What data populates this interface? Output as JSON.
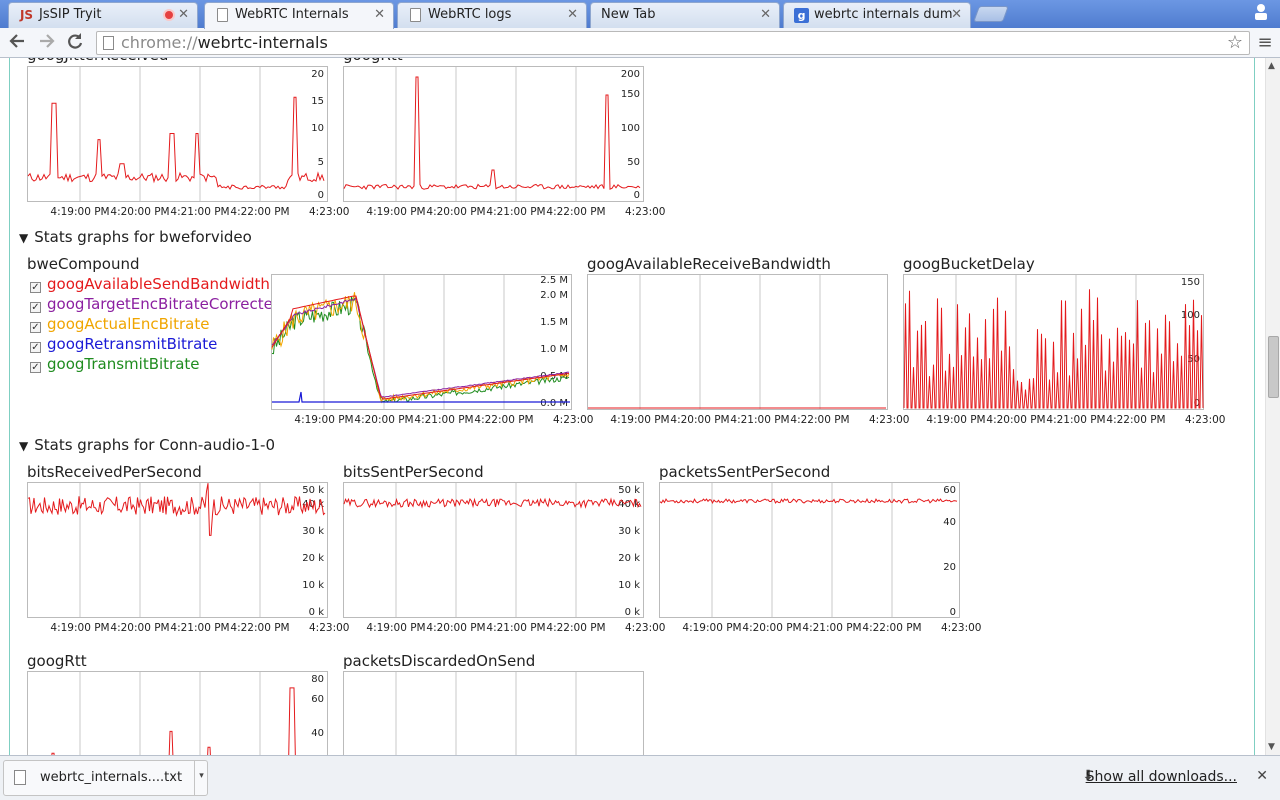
{
  "tabs": [
    {
      "title": "JsSIP Tryit",
      "favicon": "jssip-icon",
      "recording": true
    },
    {
      "title": "WebRTC Internals",
      "favicon": "page-icon",
      "active": true
    },
    {
      "title": "WebRTC logs",
      "favicon": "page-icon"
    },
    {
      "title": "New Tab",
      "favicon": "none"
    },
    {
      "title": "webrtc internals dum",
      "favicon": "google-icon"
    }
  ],
  "toolbar": {
    "url_scheme": "chrome://",
    "url_host": "webrtc-internals"
  },
  "sections": [
    {
      "title": "Stats graphs for bweforvideo"
    },
    {
      "title": "Stats graphs for Conn-audio-1-0"
    }
  ],
  "time_ticks": [
    "4:19:00 PM",
    "4:20:00 PM",
    "4:21:00 PM",
    "4:22:00 PM",
    "4:23:00"
  ],
  "graphs": {
    "g1": {
      "label": "googJitterReceived",
      "yticks": [
        "20",
        "15",
        "10",
        "5",
        "0"
      ]
    },
    "g2": {
      "label": "googRtt",
      "yticks": [
        "200",
        "150",
        "100",
        "50",
        "0"
      ]
    },
    "g3": {
      "label": "",
      "yticks": [
        "2.5 M",
        "2.0 M",
        "1.5 M",
        "1.0 M",
        "0.5 M",
        "0.0 M"
      ]
    },
    "g4": {
      "label": "googAvailableReceiveBandwidth",
      "yticks": []
    },
    "g5": {
      "label": "googBucketDelay",
      "yticks": [
        "150",
        "100",
        "50",
        "0"
      ]
    },
    "g6": {
      "label": "bitsReceivedPerSecond",
      "yticks": [
        "50 k",
        "40 k",
        "30 k",
        "20 k",
        "10 k",
        "0 k"
      ]
    },
    "g7": {
      "label": "bitsSentPerSecond",
      "yticks": [
        "50 k",
        "40 k",
        "30 k",
        "20 k",
        "10 k",
        "0 k"
      ]
    },
    "g8": {
      "label": "packetsSentPerSecond",
      "yticks": [
        "60",
        "40",
        "20",
        "0"
      ]
    },
    "g9": {
      "label": "googRtt",
      "yticks": [
        "80",
        "60",
        "40"
      ]
    },
    "g10": {
      "label": "packetsDiscardedOnSend",
      "yticks": []
    }
  },
  "bwe": {
    "label": "bweCompound",
    "legend": [
      {
        "name": "googAvailableSendBandwidth",
        "color": "#e41a1c"
      },
      {
        "name": "googTargetEncBitrateCorrected",
        "color": "#8b1fa0"
      },
      {
        "name": "googActualEncBitrate",
        "color": "#f0a500"
      },
      {
        "name": "googRetransmitBitrate",
        "color": "#1a1ad6"
      },
      {
        "name": "googTransmitBitrate",
        "color": "#1f8c1f"
      }
    ]
  },
  "downloads": {
    "file_name": "webrtc_internals....txt",
    "show_all": "Show all downloads..."
  },
  "chart_data": [
    {
      "type": "line",
      "title": "googJitterReceived",
      "ylim": [
        0,
        20
      ],
      "x": [
        "4:19:00 PM",
        "4:20:00 PM",
        "4:21:00 PM",
        "4:22:00 PM",
        "4:23:00"
      ],
      "series": [
        {
          "values": [
            3,
            14,
            3,
            8,
            4,
            3,
            12,
            2,
            2,
            16,
            1
          ]
        }
      ]
    },
    {
      "type": "line",
      "title": "googRtt",
      "ylim": [
        0,
        200
      ],
      "x": [
        "4:19:00 PM",
        "4:20:00 PM",
        "4:21:00 PM",
        "4:22:00 PM",
        "4:23:00"
      ],
      "series": [
        {
          "values": [
            8,
            190,
            8,
            10,
            25,
            8,
            10,
            8,
            160,
            8
          ]
        }
      ]
    },
    {
      "type": "line",
      "title": "bweCompound",
      "ylim": [
        0,
        2.5
      ],
      "x": [
        "4:19:00 PM",
        "4:20:00 PM",
        "4:21:00 PM",
        "4:22:00 PM",
        "4:23:00"
      ],
      "series": [
        {
          "name": "googAvailableSendBandwidth",
          "values": [
            1.2,
            1.9,
            2.0,
            0.05,
            0.1,
            0.2,
            0.35,
            0.55
          ]
        },
        {
          "name": "googActualEncBitrate",
          "values": [
            1.2,
            1.8,
            1.9,
            0.05,
            0.1,
            0.2,
            0.3,
            0.5
          ]
        },
        {
          "name": "googTransmitBitrate",
          "values": [
            1.1,
            1.8,
            1.9,
            0.05,
            0.1,
            0.2,
            0.3,
            0.5
          ]
        },
        {
          "name": "googRetransmitBitrate",
          "values": [
            0,
            0.2,
            0,
            0,
            0,
            0,
            0,
            0
          ]
        }
      ]
    },
    {
      "type": "line",
      "title": "googBucketDelay",
      "ylim": [
        0,
        150
      ],
      "x": [
        "4:19:00 PM",
        "4:20:00 PM",
        "4:21:00 PM",
        "4:22:00 PM",
        "4:23:00"
      ],
      "series": [
        {
          "values": [
            100,
            0,
            80,
            0,
            120,
            0,
            50,
            0,
            130,
            0,
            110,
            0
          ]
        }
      ]
    },
    {
      "type": "line",
      "title": "bitsReceivedPerSecond",
      "ylim": [
        0,
        50000
      ],
      "x": [
        "4:19:00 PM",
        "4:20:00 PM",
        "4:21:00 PM",
        "4:22:00 PM",
        "4:23:00"
      ],
      "series": [
        {
          "values": [
            39000,
            40000,
            38000,
            40000,
            41000,
            27000,
            40000,
            39000
          ]
        }
      ]
    },
    {
      "type": "line",
      "title": "bitsSentPerSecond",
      "ylim": [
        0,
        50000
      ],
      "x": [
        "4:19:00 PM",
        "4:20:00 PM",
        "4:21:00 PM",
        "4:22:00 PM",
        "4:23:00"
      ],
      "series": [
        {
          "values": [
            40000,
            40000,
            39000,
            40000,
            40000,
            40000
          ]
        }
      ]
    },
    {
      "type": "line",
      "title": "packetsSentPerSecond",
      "ylim": [
        0,
        60
      ],
      "x": [
        "4:19:00 PM",
        "4:20:00 PM",
        "4:21:00 PM",
        "4:22:00 PM",
        "4:23:00"
      ],
      "series": [
        {
          "values": [
            50,
            50,
            50,
            50,
            50,
            50
          ]
        }
      ]
    }
  ]
}
